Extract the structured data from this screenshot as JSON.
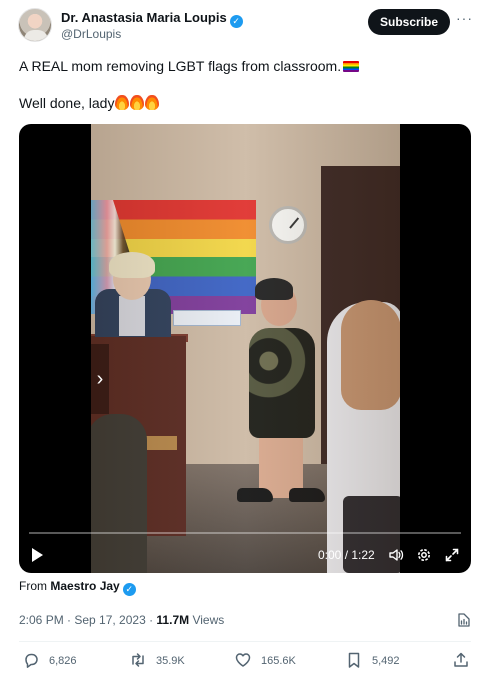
{
  "author": {
    "name": "Dr. Anastasia Maria Loupis",
    "handle": "@DrLoupis",
    "verified_icon": "verified-badge-icon"
  },
  "header": {
    "subscribe_label": "Subscribe",
    "more_label": "···"
  },
  "post": {
    "text_line1": "A REAL mom removing LGBT flags from classroom.",
    "text_line2": "Well done, lady"
  },
  "video": {
    "time": "0:00 / 1:22",
    "progress": 0,
    "icons": [
      "expand-icon",
      "play-icon",
      "volume-icon",
      "settings-icon",
      "fullscreen-icon"
    ]
  },
  "attribution": {
    "prefix": "From",
    "name": "Maestro Jay"
  },
  "meta": {
    "datetime": "2:06 PM · Sep 17, 2023 · ",
    "views_count": "11.7M",
    "views_label": " Views"
  },
  "actions": {
    "replies": "6,826",
    "reposts": "35.9K",
    "likes": "165.6K",
    "bookmarks": "5,492"
  },
  "colors": {
    "accent": "#1d9bf0",
    "text": "#0f1419",
    "secondary": "#536471"
  }
}
